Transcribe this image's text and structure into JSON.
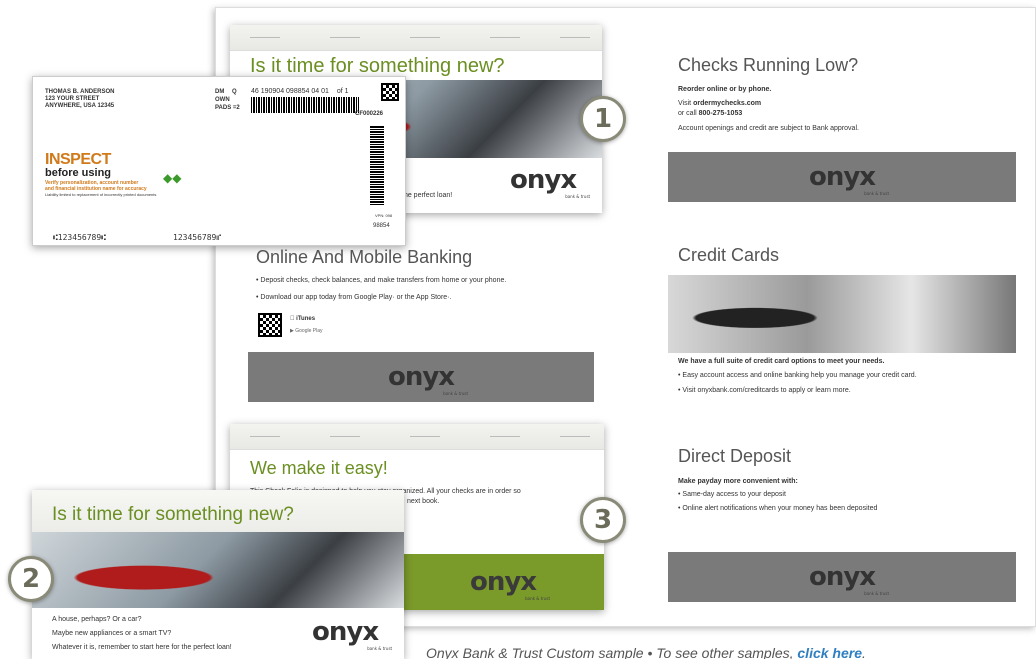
{
  "panel1": {
    "title": "Is it time for something new?",
    "line": "the perfect loan!",
    "badge": "1"
  },
  "check": {
    "name": "THOMAS B. ANDERSON",
    "street": "123 YOUR STREET",
    "city": "ANYWHERE, USA 12345",
    "dm_label": "DM",
    "dm_value": "Q",
    "own_label": "OWN",
    "pads_label": "PADS",
    "pads_value": "=2",
    "code": "46 190904 098854 04 01",
    "of": "of",
    "of_value": "1",
    "cf": "CF000226",
    "inspect": "INSPECT",
    "before": "before using",
    "verify1": "Verify personalization, account number",
    "verify2": "and financial institution name for accuracy",
    "liability": "Liability limited to replacement of incorrectly printed documents",
    "vpn": "VPN: 098",
    "num": "98854",
    "micr1": "⑆123456789⑆",
    "micr2": "123456789⑈"
  },
  "online": {
    "title": "Online And Mobile Banking",
    "bullet1": "• Deposit checks, check balances, and make transfers from home or your phone.",
    "bullet2": "• Download our app today from Google Play· or the App Store·.",
    "itunes": "iTunes",
    "gplay": "Google Play"
  },
  "easy": {
    "title": "We make it easy!",
    "text1": "This Check Folio is designed to help you stay organized. All your checks are in order so",
    "text2": "next book.",
    "badge": "3"
  },
  "panel2": {
    "title": "Is it time for something new?",
    "badge": "2",
    "line1": "A house, perhaps? Or a car?",
    "line2": "Maybe new appliances or a smart TV?",
    "line3": "Whatever it is, remember to start here for the perfect loan!"
  },
  "checks_low": {
    "title": "Checks Running Low?",
    "reorder": "Reorder online or by phone.",
    "visit": "Visit",
    "site": "ordermychecks.com",
    "call": "or call",
    "phone": "800-275-1053",
    "note": "Account openings and credit are subject to Bank approval."
  },
  "credit": {
    "title": "Credit Cards",
    "lead": "We have a full suite of credit card options to meet your needs.",
    "bullet1": "• Easy account access and online banking help you manage your credit card.",
    "bullet2": "• Visit onyxbank.com/creditcards to apply or learn more."
  },
  "deposit": {
    "title": "Direct Deposit",
    "lead": "Make payday more convenient with:",
    "bullet1": "• Same-day access to your deposit",
    "bullet2": "• Online alert notifications when your money has been deposited"
  },
  "brand": {
    "logo": "onyx",
    "sub": "bank & trust"
  },
  "caption": {
    "text": "Onyx Bank & Trust Custom sample • To see other samples, ",
    "link": "click here",
    "end": "."
  }
}
